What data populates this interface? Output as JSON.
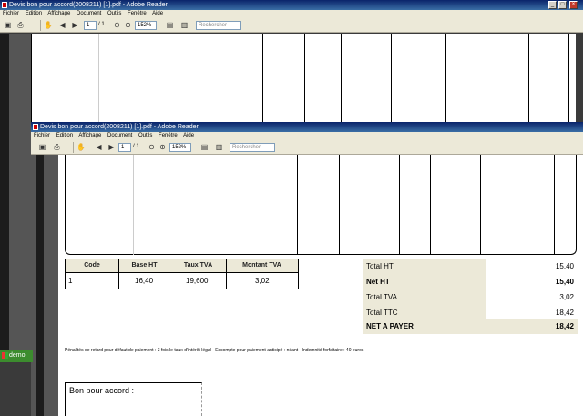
{
  "back_window": {
    "title": "Devis bon pour accord(2008211) [1].pdf - Adobe Reader",
    "menu": [
      "Fichier",
      "Edition",
      "Affichage",
      "Document",
      "Outils",
      "Fenêtre",
      "Aide"
    ],
    "page_number": "1",
    "page_count": "/ 1",
    "zoom": "152%",
    "search_placeholder": "Rechercher"
  },
  "front_window": {
    "title": "Devis bon pour accord(2008211) [1].pdf - Adobe Reader",
    "menu": [
      "Fichier",
      "Edition",
      "Affichage",
      "Document",
      "Outils",
      "Fenêtre",
      "Aide"
    ],
    "page_number": "1",
    "page_count": "/ 1",
    "zoom": "152%",
    "search_placeholder": "Rechercher"
  },
  "tva_table": {
    "headers": [
      "Code",
      "Base HT",
      "Taux TVA",
      "Montant TVA"
    ],
    "rows": [
      [
        "1",
        "16,40",
        "19,600",
        "3,02"
      ]
    ]
  },
  "totals": [
    {
      "label": "Total HT",
      "value": "15,40",
      "bold": false
    },
    {
      "label": "Net HT",
      "value": "15,40",
      "bold": true
    },
    {
      "label": "Total TVA",
      "value": "3,02",
      "bold": false
    },
    {
      "label": "Total TTC",
      "value": "18,42",
      "bold": false
    },
    {
      "label": "NET A PAYER",
      "value": "18,42",
      "bold": true
    }
  ],
  "footer_note": "Pénalités de retard pour défaut de paiement : 3 fois le taux d'intérêt légal - Escompte pour paiement anticipé : néant - Indemnité forfaitaire : 40 euros",
  "bon_pour_accord": "Bon pour accord :",
  "taskbar": {
    "button": "demo"
  },
  "colors": {
    "title_blue": "#0a246a",
    "panel_beige": "#ece9d8",
    "taskbar_green": "#3c8c2e"
  }
}
